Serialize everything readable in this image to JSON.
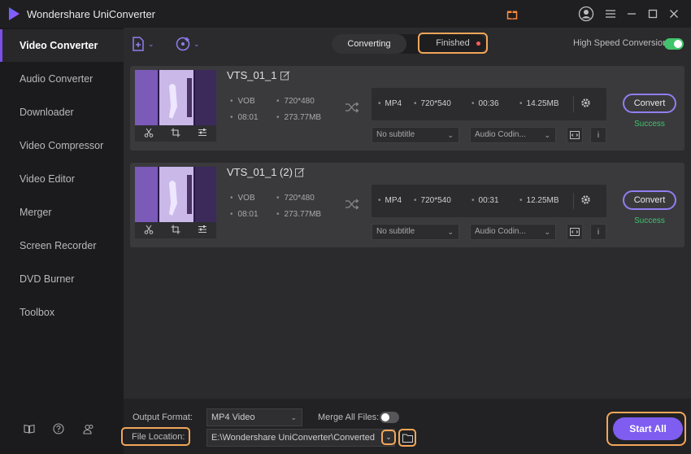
{
  "app": {
    "title": "Wondershare UniConverter"
  },
  "sidebar": {
    "items": [
      {
        "label": "Video Converter",
        "active": true
      },
      {
        "label": "Audio Converter"
      },
      {
        "label": "Downloader"
      },
      {
        "label": "Video Compressor"
      },
      {
        "label": "Video Editor"
      },
      {
        "label": "Merger"
      },
      {
        "label": "Screen Recorder"
      },
      {
        "label": "DVD Burner"
      },
      {
        "label": "Toolbox"
      }
    ]
  },
  "tabs": {
    "converting": "Converting",
    "finished": "Finished"
  },
  "high_speed": {
    "label": "High Speed Conversion",
    "enabled": true
  },
  "files": [
    {
      "name": "VTS_01_1",
      "source": {
        "format": "VOB",
        "resolution": "720*480",
        "duration": "08:01",
        "size": "273.77MB"
      },
      "output": {
        "format": "MP4",
        "resolution": "720*540",
        "duration": "00:36",
        "size": "14.25MB"
      },
      "subtitle": "No subtitle",
      "audio": "Audio Codin...",
      "convert_label": "Convert",
      "status": "Success"
    },
    {
      "name": "VTS_01_1 (2)",
      "source": {
        "format": "VOB",
        "resolution": "720*480",
        "duration": "08:01",
        "size": "273.77MB"
      },
      "output": {
        "format": "MP4",
        "resolution": "720*540",
        "duration": "00:31",
        "size": "12.25MB"
      },
      "subtitle": "No subtitle",
      "audio": "Audio Codin...",
      "convert_label": "Convert",
      "status": "Success"
    }
  ],
  "footer": {
    "output_format_label": "Output Format:",
    "output_format_value": "MP4 Video",
    "merge_label": "Merge All Files:",
    "merge_enabled": false,
    "file_location_label": "File Location:",
    "file_location_value": "E:\\Wondershare UniConverter\\Converted",
    "start_all_label": "Start All"
  },
  "colors": {
    "accent": "#7e5df0",
    "highlight": "#f2a65a",
    "success": "#3fc46b",
    "toggle_on": "#3fc46b"
  }
}
